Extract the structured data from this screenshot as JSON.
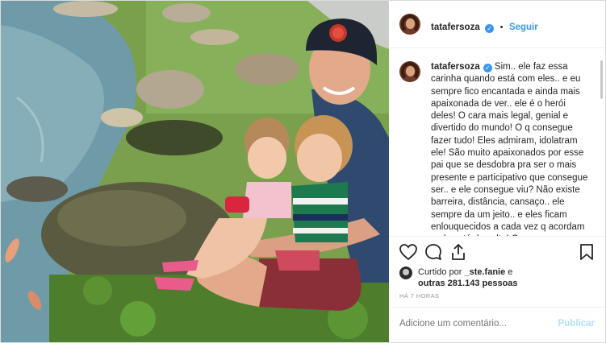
{
  "post": {
    "username": "tatafersoza",
    "verified_glyph": "✓",
    "separator": "•",
    "follow_label": "Seguir",
    "caption_username": "tatafersoza",
    "caption_text": "Sim.. ele faz essa carinha quando está com eles.. e eu sempre fico encantada e ainda mais apaixonada de ver.. ele é o herói deles! O cara mais legal, genial e divertido do mundo! O q consegue fazer tudo! Eles admiram, idolatram ele! São muito apaixonados por esse pai que se desdobra pra ser o mais presente e participativo que consegue ser.. e ele consegue viu? Não existe barreira, distância, cansaço.. ele sempre da um jeito.. e eles ficam enlouquecidos a cada vez q acordam e ele está de volta! Que",
    "likes_prefix": "Curtido por",
    "likes_user": "_ste.fanie",
    "likes_joiner": "e",
    "likes_others": "outras 281.143 pessoas",
    "timestamp": "há 7 horas",
    "comment_placeholder": "Adicione um comentário...",
    "publish_label": "Publicar"
  },
  "icons": {
    "like": "heart-icon",
    "comment": "comment-bubble-icon",
    "share": "share-arrow-icon",
    "save": "bookmark-icon",
    "verified": "verified-badge-icon"
  },
  "colors": {
    "link_blue": "#3897f0",
    "verified_blue": "#3897f0",
    "publish_disabled": "#b2dffc",
    "muted_gray": "#999999",
    "border": "#dbdbdb"
  }
}
